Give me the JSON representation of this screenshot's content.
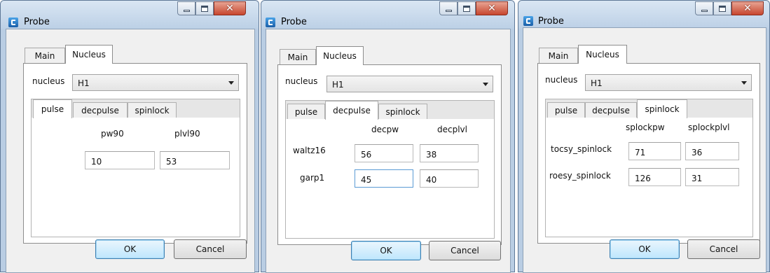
{
  "windows": [
    {
      "title": "Probe",
      "outer_tabs": [
        "Main",
        "Nucleus"
      ],
      "nucleus_label": "nucleus",
      "nucleus_value": "H1",
      "inner_tabs": [
        "pulse",
        "decpulse",
        "spinlock"
      ],
      "active_inner_tab": "pulse",
      "columns": [
        "pw90",
        "plvl90"
      ],
      "rows": [
        {
          "label": "",
          "values": [
            "10",
            "53"
          ]
        }
      ],
      "ok_label": "OK",
      "cancel_label": "Cancel"
    },
    {
      "title": "Probe",
      "outer_tabs": [
        "Main",
        "Nucleus"
      ],
      "nucleus_label": "nucleus",
      "nucleus_value": "H1",
      "inner_tabs": [
        "pulse",
        "decpulse",
        "spinlock"
      ],
      "active_inner_tab": "decpulse",
      "columns": [
        "decpw",
        "decplvl"
      ],
      "rows": [
        {
          "label": "waltz16",
          "values": [
            "56",
            "38"
          ]
        },
        {
          "label": "garp1",
          "values": [
            "45",
            "40"
          ]
        }
      ],
      "ok_label": "OK",
      "cancel_label": "Cancel"
    },
    {
      "title": "Probe",
      "outer_tabs": [
        "Main",
        "Nucleus"
      ],
      "nucleus_label": "nucleus",
      "nucleus_value": "H1",
      "inner_tabs": [
        "pulse",
        "decpulse",
        "spinlock"
      ],
      "active_inner_tab": "spinlock",
      "columns": [
        "splockpw",
        "splockplvl"
      ],
      "rows": [
        {
          "label": "tocsy_spinlock",
          "values": [
            "71",
            "36"
          ]
        },
        {
          "label": "roesy_spinlock",
          "values": [
            "126",
            "31"
          ]
        }
      ],
      "ok_label": "OK",
      "cancel_label": "Cancel"
    }
  ]
}
